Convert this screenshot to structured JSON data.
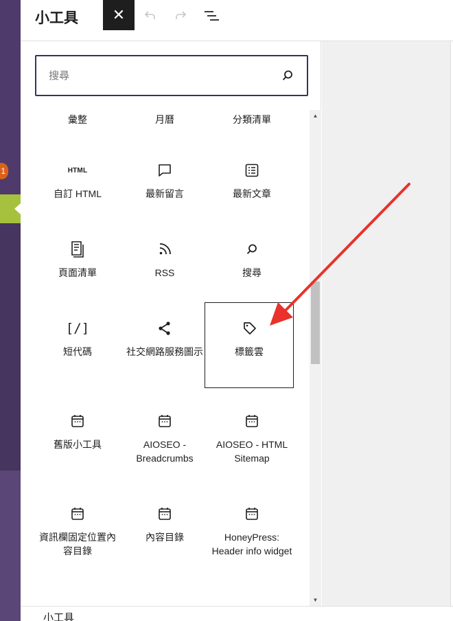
{
  "header": {
    "title": "小工具",
    "close_label": "✕"
  },
  "search": {
    "placeholder": "搜尋"
  },
  "admin_menu": {
    "badge_count": "1"
  },
  "widgets": [
    {
      "label": "彙整",
      "icon": "archive-icon"
    },
    {
      "label": "月曆",
      "icon": "calendar-icon"
    },
    {
      "label": "分類清單",
      "icon": "categories-icon"
    },
    {
      "label": "自訂 HTML",
      "icon": "html-icon",
      "icon_text": "HTML"
    },
    {
      "label": "最新留言",
      "icon": "comment-icon"
    },
    {
      "label": "最新文章",
      "icon": "post-list-icon"
    },
    {
      "label": "頁面清單",
      "icon": "page-list-icon"
    },
    {
      "label": "RSS",
      "icon": "rss-icon"
    },
    {
      "label": "搜尋",
      "icon": "search-icon"
    },
    {
      "label": "短代碼",
      "icon": "shortcode-icon",
      "icon_text": "[/]"
    },
    {
      "label": "社交網路服務圖示",
      "icon": "share-icon"
    },
    {
      "label": "標籤雲",
      "icon": "tag-icon",
      "selected": true
    },
    {
      "label": "舊版小工具",
      "icon": "legacy-calendar-icon"
    },
    {
      "label": "AIOSEO - Breadcrumbs",
      "icon": "legacy-calendar-icon"
    },
    {
      "label": "AIOSEO - HTML Sitemap",
      "icon": "legacy-calendar-icon"
    },
    {
      "label": "資訊欄固定位置內容目錄",
      "icon": "legacy-calendar-icon"
    },
    {
      "label": "內容目錄",
      "icon": "legacy-calendar-icon"
    },
    {
      "label": "HoneyPress: Header info widget",
      "icon": "legacy-calendar-icon"
    }
  ],
  "footer": {
    "label": "小工具"
  },
  "colors": {
    "admin_sidebar": "#4e3a6b",
    "active_tab": "#a5c13d",
    "badge": "#d9621b",
    "search_border": "#3c2f5e",
    "annotation_arrow": "#e8322b"
  }
}
